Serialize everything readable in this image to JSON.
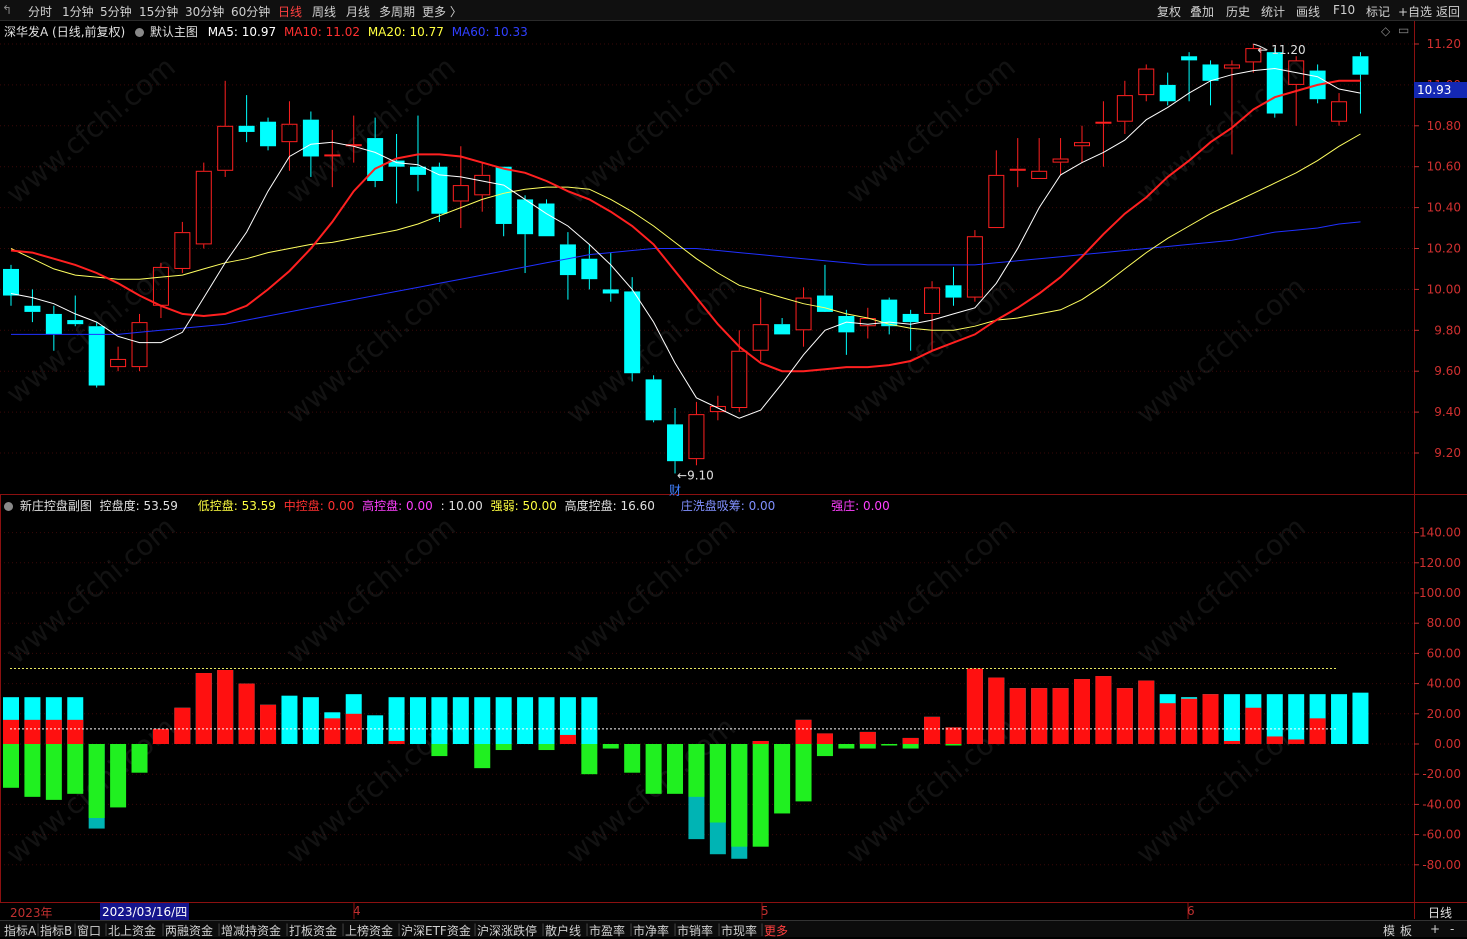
{
  "toolbar": {
    "periods": [
      "分时",
      "1分钟",
      "5分钟",
      "15分钟",
      "30分钟",
      "60分钟",
      "日线",
      "周线",
      "月线",
      "多周期",
      "更多 〉"
    ],
    "active_period": "日线",
    "right_buttons": [
      "复权",
      "叠加",
      "历史",
      "统计",
      "画线",
      "F10",
      "标记",
      "+自选",
      "返回"
    ]
  },
  "main_legend": {
    "stock": "深华发A (日线,前复权)",
    "template": "默认主图",
    "ma5": "MA5: 10.97",
    "ma10": "MA10: 11.02",
    "ma20": "MA20: 10.77",
    "ma60": "MA60: 10.33"
  },
  "sub_legend": {
    "name": "新庄控盘副图",
    "kpd": "控盘度: 53.59",
    "low": "低控盘: 53.59",
    "mid": "中控盘: 0.00",
    "high": "高控盘: 0.00",
    "ten": ": 10.00",
    "strength": "强弱: 50.00",
    "hkpd": "高度控盘: 16.60",
    "wash": "庄洗盘吸筹: 0.00",
    "strong": "强庄: 0.00"
  },
  "price_axis": [
    "11.20",
    "11.00",
    "10.80",
    "10.60",
    "10.40",
    "10.20",
    "10.00",
    "9.80",
    "9.60",
    "9.40",
    "9.20"
  ],
  "current_price": "10.93",
  "sub_axis": [
    "140.00",
    "120.00",
    "100.00",
    "80.00",
    "60.00",
    "40.00",
    "20.00",
    "0.00",
    "-20.00",
    "-40.00",
    "-60.00",
    "-80.00"
  ],
  "annotations": {
    "high_label": "11.20",
    "low_label": "9.10",
    "cai": "财"
  },
  "dates": {
    "year": "2023年",
    "cursor": "2023/03/16/四",
    "m4": "4",
    "m5": "5",
    "m6": "6",
    "period": "日线"
  },
  "bottom_tabs": [
    "指标A",
    "指标B",
    "窗口",
    "北上资金",
    "两融资金",
    "增减持资金",
    "打板资金",
    "上榜资金",
    "沪深ETF资金",
    "沪深涨跌停",
    "散户线",
    "市盈率",
    "市净率",
    "市销率",
    "市现率",
    "更多"
  ],
  "bottom_right": [
    "模",
    "板",
    "+",
    "-"
  ],
  "watermark": "www.cfchi.com",
  "colors": {
    "up": "#ff2020",
    "down": "#00ffff",
    "ma5": "#ffffff",
    "ma10": "#ff2020",
    "ma20": "#ffff60",
    "ma60": "#2030ff"
  },
  "chart_data": [
    {
      "type": "candlestick",
      "title": "深华发A (日线,前复权)",
      "ylim": [
        9.1,
        11.25
      ],
      "candles": [
        {
          "o": 10.1,
          "h": 10.12,
          "l": 9.92,
          "c": 9.97
        },
        {
          "o": 9.92,
          "h": 10.0,
          "l": 9.84,
          "c": 9.89
        },
        {
          "o": 9.88,
          "h": 9.92,
          "l": 9.7,
          "c": 9.78
        },
        {
          "o": 9.85,
          "h": 9.97,
          "l": 9.82,
          "c": 9.83
        },
        {
          "o": 9.82,
          "h": 9.84,
          "l": 9.52,
          "c": 9.53
        },
        {
          "o": 9.62,
          "h": 9.72,
          "l": 9.6,
          "c": 9.66
        },
        {
          "o": 9.62,
          "h": 9.88,
          "l": 9.6,
          "c": 9.84
        },
        {
          "o": 9.92,
          "h": 10.13,
          "l": 9.86,
          "c": 10.11
        },
        {
          "o": 10.1,
          "h": 10.33,
          "l": 10.08,
          "c": 10.28
        },
        {
          "o": 10.22,
          "h": 10.62,
          "l": 10.2,
          "c": 10.58
        },
        {
          "o": 10.58,
          "h": 11.02,
          "l": 10.55,
          "c": 10.8
        },
        {
          "o": 10.8,
          "h": 10.95,
          "l": 10.72,
          "c": 10.77
        },
        {
          "o": 10.82,
          "h": 10.84,
          "l": 10.68,
          "c": 10.7
        },
        {
          "o": 10.72,
          "h": 10.92,
          "l": 10.58,
          "c": 10.81
        },
        {
          "o": 10.83,
          "h": 10.87,
          "l": 10.55,
          "c": 10.65
        },
        {
          "o": 10.66,
          "h": 10.78,
          "l": 10.5,
          "c": 10.66
        },
        {
          "o": 10.7,
          "h": 10.85,
          "l": 10.62,
          "c": 10.71
        },
        {
          "o": 10.74,
          "h": 10.84,
          "l": 10.5,
          "c": 10.53
        },
        {
          "o": 10.63,
          "h": 10.76,
          "l": 10.42,
          "c": 10.6
        },
        {
          "o": 10.6,
          "h": 10.85,
          "l": 10.48,
          "c": 10.56
        },
        {
          "o": 10.6,
          "h": 10.62,
          "l": 10.33,
          "c": 10.37
        },
        {
          "o": 10.43,
          "h": 10.7,
          "l": 10.3,
          "c": 10.51
        },
        {
          "o": 10.46,
          "h": 10.62,
          "l": 10.38,
          "c": 10.56
        },
        {
          "o": 10.6,
          "h": 10.6,
          "l": 10.26,
          "c": 10.32
        },
        {
          "o": 10.44,
          "h": 10.46,
          "l": 10.08,
          "c": 10.27
        },
        {
          "o": 10.42,
          "h": 10.44,
          "l": 10.26,
          "c": 10.26
        },
        {
          "o": 10.22,
          "h": 10.28,
          "l": 9.95,
          "c": 10.07
        },
        {
          "o": 10.15,
          "h": 10.22,
          "l": 10.0,
          "c": 10.05
        },
        {
          "o": 10.0,
          "h": 10.18,
          "l": 9.94,
          "c": 9.98
        },
        {
          "o": 9.99,
          "h": 10.06,
          "l": 9.55,
          "c": 9.59
        },
        {
          "o": 9.56,
          "h": 9.58,
          "l": 9.35,
          "c": 9.36
        },
        {
          "o": 9.34,
          "h": 9.42,
          "l": 9.1,
          "c": 9.16
        },
        {
          "o": 9.17,
          "h": 9.45,
          "l": 9.14,
          "c": 9.39
        },
        {
          "o": 9.4,
          "h": 9.48,
          "l": 9.36,
          "c": 9.43
        },
        {
          "o": 9.42,
          "h": 9.8,
          "l": 9.4,
          "c": 9.7
        },
        {
          "o": 9.7,
          "h": 9.96,
          "l": 9.65,
          "c": 9.83
        },
        {
          "o": 9.83,
          "h": 9.86,
          "l": 9.78,
          "c": 9.78
        },
        {
          "o": 9.8,
          "h": 10.01,
          "l": 9.72,
          "c": 9.96
        },
        {
          "o": 9.97,
          "h": 10.12,
          "l": 9.9,
          "c": 9.89
        },
        {
          "o": 9.87,
          "h": 9.9,
          "l": 9.68,
          "c": 9.79
        },
        {
          "o": 9.82,
          "h": 9.91,
          "l": 9.76,
          "c": 9.86
        },
        {
          "o": 9.95,
          "h": 9.96,
          "l": 9.78,
          "c": 9.82
        },
        {
          "o": 9.88,
          "h": 9.9,
          "l": 9.7,
          "c": 9.84
        },
        {
          "o": 9.88,
          "h": 10.04,
          "l": 9.7,
          "c": 10.01
        },
        {
          "o": 10.02,
          "h": 10.11,
          "l": 9.92,
          "c": 9.96
        },
        {
          "o": 9.96,
          "h": 10.29,
          "l": 9.94,
          "c": 10.26
        },
        {
          "o": 10.3,
          "h": 10.68,
          "l": 10.3,
          "c": 10.56
        },
        {
          "o": 10.58,
          "h": 10.74,
          "l": 10.5,
          "c": 10.59
        },
        {
          "o": 10.54,
          "h": 10.74,
          "l": 10.54,
          "c": 10.58
        },
        {
          "o": 10.62,
          "h": 10.74,
          "l": 10.56,
          "c": 10.64
        },
        {
          "o": 10.7,
          "h": 10.8,
          "l": 10.62,
          "c": 10.72
        },
        {
          "o": 10.82,
          "h": 10.92,
          "l": 10.6,
          "c": 10.82
        },
        {
          "o": 10.82,
          "h": 11.02,
          "l": 10.76,
          "c": 10.95
        },
        {
          "o": 10.95,
          "h": 11.1,
          "l": 10.92,
          "c": 11.08
        },
        {
          "o": 11.0,
          "h": 11.06,
          "l": 10.9,
          "c": 10.92
        },
        {
          "o": 11.14,
          "h": 11.16,
          "l": 10.92,
          "c": 11.12
        },
        {
          "o": 11.1,
          "h": 11.12,
          "l": 10.9,
          "c": 11.02
        },
        {
          "o": 11.08,
          "h": 11.12,
          "l": 10.66,
          "c": 11.1
        },
        {
          "o": 11.11,
          "h": 11.2,
          "l": 11.06,
          "c": 11.18
        },
        {
          "o": 11.16,
          "h": 11.18,
          "l": 10.84,
          "c": 10.86
        },
        {
          "o": 11.0,
          "h": 11.14,
          "l": 10.8,
          "c": 11.12
        },
        {
          "o": 11.07,
          "h": 11.1,
          "l": 10.91,
          "c": 10.93
        },
        {
          "o": 10.82,
          "h": 10.96,
          "l": 10.8,
          "c": 10.92
        },
        {
          "o": 11.14,
          "h": 11.16,
          "l": 10.86,
          "c": 11.05
        }
      ],
      "ma5": [
        9.98,
        9.96,
        9.93,
        9.88,
        9.84,
        9.77,
        9.74,
        9.74,
        9.79,
        9.96,
        10.13,
        10.28,
        10.48,
        10.65,
        10.71,
        10.72,
        10.7,
        10.67,
        10.62,
        10.61,
        10.56,
        10.55,
        10.53,
        10.51,
        10.44,
        10.37,
        10.31,
        10.22,
        10.12,
        10.0,
        9.84,
        9.64,
        9.47,
        9.42,
        9.37,
        9.41,
        9.54,
        9.68,
        9.8,
        9.84,
        9.83,
        9.84,
        9.83,
        9.85,
        9.88,
        9.91,
        10.03,
        10.2,
        10.4,
        10.56,
        10.62,
        10.67,
        10.73,
        10.83,
        10.89,
        10.96,
        11.02,
        11.05,
        11.07,
        11.08,
        11.06,
        11.04,
        10.98,
        10.96
      ],
      "ma10": [
        10.19,
        10.18,
        10.15,
        10.12,
        10.08,
        10.03,
        9.97,
        9.92,
        9.88,
        9.87,
        9.88,
        9.92,
        10.0,
        10.09,
        10.2,
        10.33,
        10.48,
        10.59,
        10.64,
        10.66,
        10.66,
        10.65,
        10.62,
        10.59,
        10.57,
        10.53,
        10.48,
        10.44,
        10.38,
        10.31,
        10.22,
        10.09,
        9.96,
        9.83,
        9.72,
        9.64,
        9.6,
        9.6,
        9.61,
        9.62,
        9.62,
        9.63,
        9.65,
        9.7,
        9.74,
        9.78,
        9.85,
        9.91,
        9.98,
        10.06,
        10.16,
        10.27,
        10.37,
        10.45,
        10.55,
        10.63,
        10.72,
        10.79,
        10.88,
        10.94,
        10.97,
        11.0,
        11.02,
        11.02
      ],
      "ma20": [
        10.2,
        10.15,
        10.1,
        10.07,
        10.06,
        10.05,
        10.05,
        10.06,
        10.07,
        10.1,
        10.13,
        10.15,
        10.18,
        10.2,
        10.22,
        10.23,
        10.25,
        10.27,
        10.29,
        10.32,
        10.36,
        10.4,
        10.44,
        10.47,
        10.49,
        10.5,
        10.5,
        10.49,
        10.44,
        10.38,
        10.31,
        10.23,
        10.15,
        10.08,
        10.02,
        9.99,
        9.96,
        9.93,
        9.91,
        9.88,
        9.86,
        9.83,
        9.81,
        9.8,
        9.8,
        9.82,
        9.85,
        9.86,
        9.88,
        9.9,
        9.95,
        10.02,
        10.1,
        10.18,
        10.25,
        10.31,
        10.37,
        10.42,
        10.47,
        10.52,
        10.57,
        10.63,
        10.7,
        10.76
      ],
      "ma60": [
        9.78,
        9.78,
        9.78,
        9.78,
        9.78,
        9.78,
        9.79,
        9.8,
        9.81,
        9.82,
        9.83,
        9.85,
        9.87,
        9.89,
        9.91,
        9.93,
        9.95,
        9.97,
        9.99,
        10.01,
        10.03,
        10.05,
        10.07,
        10.09,
        10.11,
        10.13,
        10.15,
        10.17,
        10.18,
        10.19,
        10.2,
        10.2,
        10.2,
        10.19,
        10.18,
        10.17,
        10.16,
        10.15,
        10.14,
        10.13,
        10.12,
        10.12,
        10.12,
        10.12,
        10.12,
        10.12,
        10.13,
        10.14,
        10.15,
        10.16,
        10.17,
        10.18,
        10.19,
        10.2,
        10.21,
        10.22,
        10.23,
        10.24,
        10.26,
        10.28,
        10.29,
        10.3,
        10.32,
        10.33
      ]
    },
    {
      "type": "bar",
      "title": "新庄控盘副图",
      "ylim": [
        -100,
        160
      ],
      "ref_lines": [
        10,
        50
      ],
      "control": [
        31,
        31,
        31,
        31,
        0,
        0,
        0,
        10,
        24,
        47,
        49,
        40,
        26,
        32,
        31,
        21,
        33,
        19,
        31,
        31,
        31,
        31,
        31,
        31,
        31,
        31,
        31,
        31,
        0,
        0,
        0,
        0,
        0,
        0,
        0,
        2,
        -3,
        16,
        7,
        -3,
        8,
        -1,
        4,
        18,
        11,
        50,
        44,
        37,
        37,
        37,
        43,
        45,
        37,
        42,
        33,
        31,
        33,
        33,
        33,
        33,
        33,
        33,
        33,
        34
      ],
      "strength": [
        16,
        16,
        16,
        16,
        0,
        0,
        0,
        10,
        24,
        47,
        49,
        40,
        26,
        0,
        0,
        17,
        20,
        0,
        2,
        0,
        0,
        0,
        0,
        0,
        0,
        0,
        6,
        0,
        0,
        0,
        0,
        0,
        0,
        0,
        0,
        2,
        0,
        16,
        7,
        0,
        8,
        0,
        4,
        18,
        11,
        50,
        44,
        37,
        37,
        37,
        43,
        45,
        37,
        42,
        27,
        30,
        33,
        2,
        24,
        5,
        3,
        17
      ],
      "green": [
        -29,
        -35,
        -37,
        -33,
        -49,
        -42,
        -19,
        0,
        0,
        0,
        0,
        0,
        0,
        0,
        0,
        0,
        0,
        0,
        0,
        0,
        -8,
        0,
        -16,
        -4,
        0,
        -4,
        0,
        -20,
        -3,
        -19,
        -33,
        -33,
        -35,
        -52,
        -68,
        -68,
        -46,
        -38,
        -8,
        0,
        -3,
        0,
        -3,
        0,
        -1,
        0,
        0,
        0,
        0,
        0,
        0,
        0,
        0,
        0,
        0,
        0,
        0,
        0,
        0,
        0,
        0,
        0,
        0,
        0
      ],
      "wash": [
        0,
        0,
        0,
        0,
        -56,
        0,
        0,
        0,
        0,
        0,
        0,
        0,
        0,
        0,
        0,
        0,
        0,
        0,
        0,
        0,
        0,
        0,
        0,
        0,
        0,
        0,
        0,
        0,
        0,
        0,
        0,
        0,
        -63,
        -73,
        -76,
        0,
        0,
        0,
        0,
        0,
        0,
        0,
        0,
        0,
        0,
        0,
        0,
        0,
        0,
        0,
        0,
        0,
        0,
        0,
        0,
        0,
        0,
        0,
        0,
        0,
        0,
        0,
        0,
        0
      ]
    }
  ]
}
